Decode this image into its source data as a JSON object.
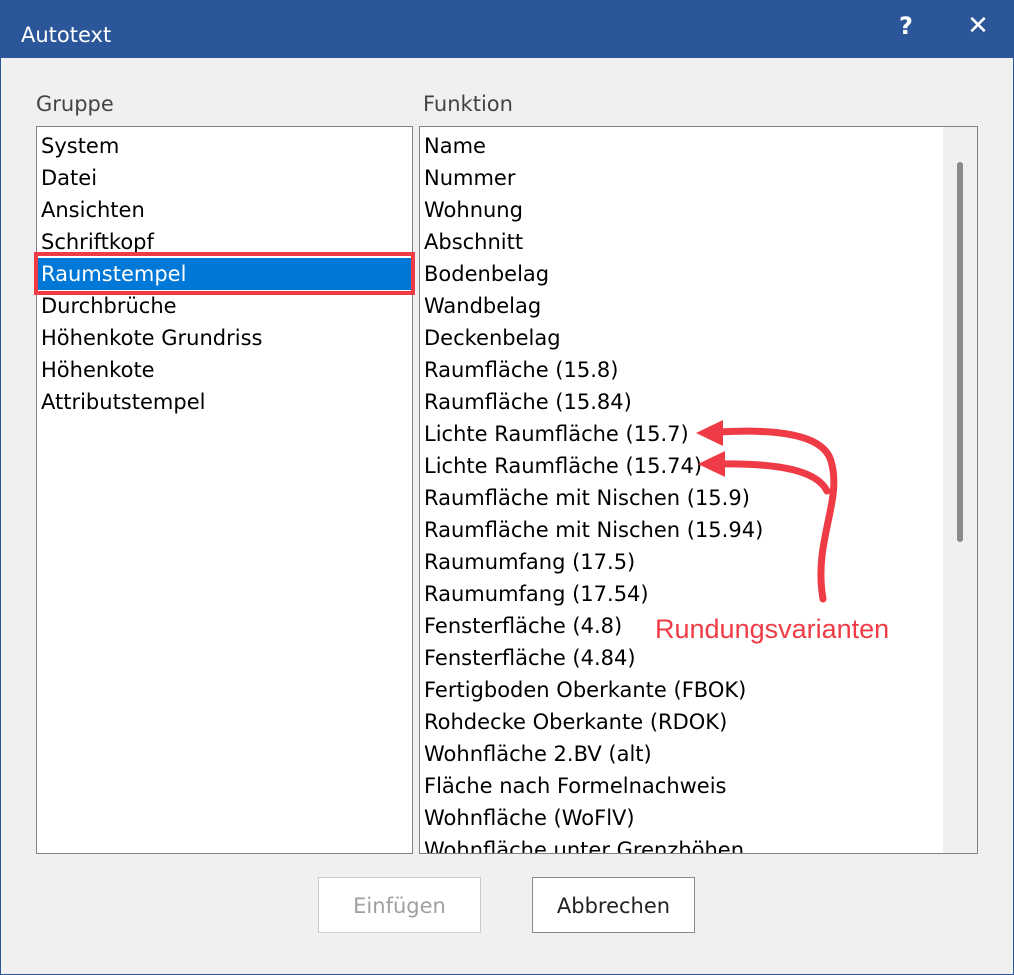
{
  "window": {
    "title": "Autotext",
    "help_label": "?",
    "close_label": "✕"
  },
  "gruppe": {
    "label": "Gruppe",
    "items": [
      "System",
      "Datei",
      "Ansichten",
      "Schriftkopf",
      "Raumstempel",
      "Durchbrüche",
      "Höhenkote Grundriss",
      "Höhenkote",
      "Attributstempel"
    ],
    "selected": "Raumstempel"
  },
  "funktion": {
    "label": "Funktion",
    "items": [
      "Name",
      "Nummer",
      "Wohnung",
      "Abschnitt",
      "Bodenbelag",
      "Wandbelag",
      "Deckenbelag",
      "Raumfläche (15.8)",
      "Raumfläche (15.84)",
      "Lichte Raumfläche (15.7)",
      "Lichte Raumfläche (15.74)",
      "Raumfläche mit Nischen (15.9)",
      "Raumfläche mit Nischen (15.94)",
      "Raumumfang (17.5)",
      "Raumumfang (17.54)",
      "Fensterfläche (4.8)",
      "Fensterfläche (4.84)",
      "Fertigboden Oberkante (FBOK)",
      "Rohdecke Oberkante (RDOK)",
      "Wohnfläche 2.BV (alt)",
      "Fläche nach Formelnachweis",
      "Wohnfläche (WoFlV)",
      "Wohnfläche unter Grenzhöhen"
    ]
  },
  "buttons": {
    "insert_label": "Einfügen",
    "cancel_label": "Abbrechen"
  },
  "annotation": {
    "text": "Rundungsvarianten",
    "color": "#ef3b45"
  },
  "icons": {
    "help": "help-icon",
    "close": "close-icon"
  }
}
